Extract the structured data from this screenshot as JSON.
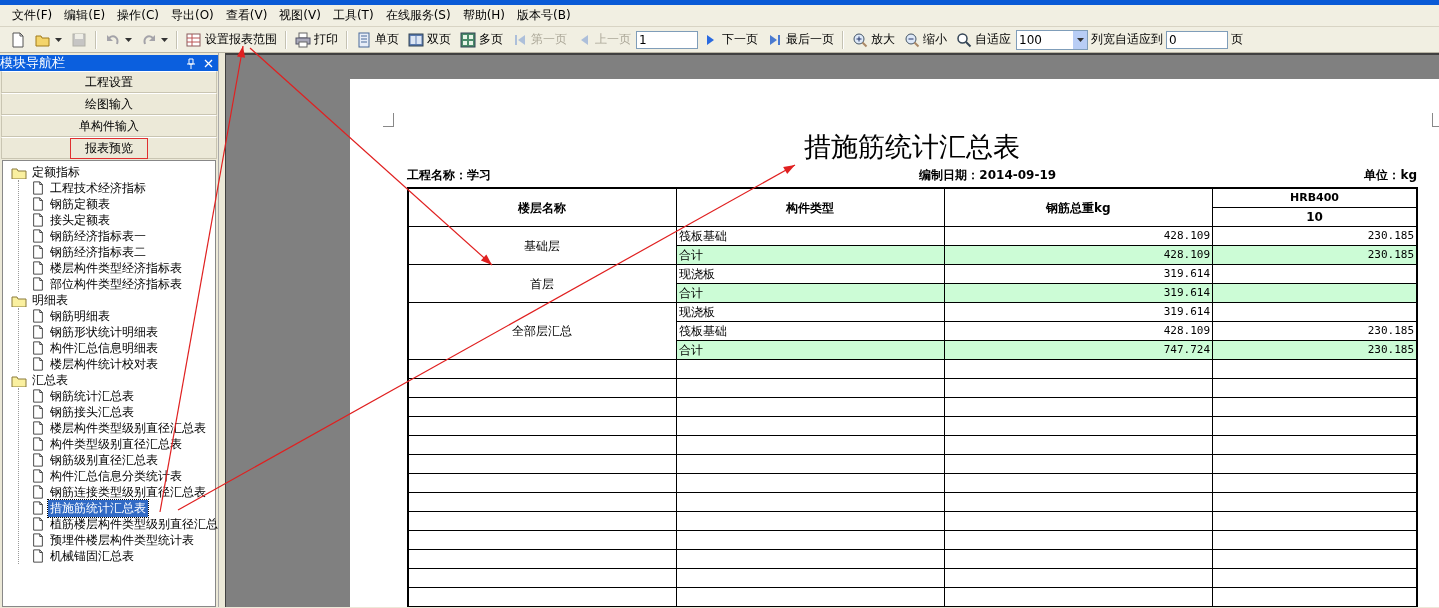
{
  "menu": [
    {
      "label": "文件(F)"
    },
    {
      "label": "编辑(E)"
    },
    {
      "label": "操作(C)"
    },
    {
      "label": "导出(O)"
    },
    {
      "label": "查看(V)"
    },
    {
      "label": "视图(V)"
    },
    {
      "label": "工具(T)"
    },
    {
      "label": "在线服务(S)"
    },
    {
      "label": "帮助(H)"
    },
    {
      "label": "版本号(B)"
    }
  ],
  "toolbar": [
    {
      "kind": "icon-button",
      "disabled": false,
      "dropdown": false
    },
    {
      "kind": "icon-button",
      "disabled": false,
      "dropdown": true
    },
    {
      "kind": "icon-button",
      "disabled": true,
      "dropdown": false
    },
    {
      "kind": "separator"
    },
    {
      "kind": "icon-button",
      "disabled": true,
      "dropdown": true
    },
    {
      "kind": "icon-button",
      "disabled": true,
      "dropdown": true
    },
    {
      "kind": "separator"
    },
    {
      "kind": "button",
      "label": "设置报表范围",
      "disabled": false
    },
    {
      "kind": "separator"
    },
    {
      "kind": "button",
      "label": "打印",
      "disabled": false
    },
    {
      "kind": "separator"
    },
    {
      "kind": "button",
      "label": "单页",
      "disabled": false
    },
    {
      "kind": "button",
      "label": "双页",
      "disabled": false
    },
    {
      "kind": "button",
      "label": "多页",
      "disabled": false
    },
    {
      "kind": "button",
      "label": "第一页",
      "disabled": true
    },
    {
      "kind": "button",
      "label": "上一页",
      "disabled": true
    },
    {
      "kind": "input",
      "value": "1"
    },
    {
      "kind": "button",
      "label": "下一页",
      "disabled": false
    },
    {
      "kind": "button",
      "label": "最后一页",
      "disabled": false
    },
    {
      "kind": "separator"
    },
    {
      "kind": "button",
      "label": "放大",
      "disabled": false
    },
    {
      "kind": "button",
      "label": "缩小",
      "disabled": false
    },
    {
      "kind": "button",
      "label": "自适应",
      "disabled": false
    },
    {
      "kind": "select",
      "value": "100"
    },
    {
      "kind": "text",
      "label": "列宽自适应到"
    },
    {
      "kind": "input",
      "value": "0"
    },
    {
      "kind": "text",
      "label": "页"
    }
  ],
  "sidebar": {
    "title": "模块导航栏",
    "modules": [
      {
        "label": "工程设置",
        "highlighted": false
      },
      {
        "label": "绘图输入",
        "highlighted": false
      },
      {
        "label": "单构件输入",
        "highlighted": false
      },
      {
        "label": "报表预览",
        "highlighted": true
      }
    ],
    "tree": [
      {
        "label": "定额指标",
        "selected": false,
        "children": [
          {
            "label": "工程技术经济指标",
            "selected": false
          },
          {
            "label": "钢筋定额表",
            "selected": false
          },
          {
            "label": "接头定额表",
            "selected": false
          },
          {
            "label": "钢筋经济指标表一",
            "selected": false
          },
          {
            "label": "钢筋经济指标表二",
            "selected": false
          },
          {
            "label": "楼层构件类型经济指标表",
            "selected": false
          },
          {
            "label": "部位构件类型经济指标表",
            "selected": false
          }
        ]
      },
      {
        "label": "明细表",
        "selected": false,
        "children": [
          {
            "label": "钢筋明细表",
            "selected": false
          },
          {
            "label": "钢筋形状统计明细表",
            "selected": false
          },
          {
            "label": "构件汇总信息明细表",
            "selected": false
          },
          {
            "label": "楼层构件统计校对表",
            "selected": false
          }
        ]
      },
      {
        "label": "汇总表",
        "selected": false,
        "children": [
          {
            "label": "钢筋统计汇总表",
            "selected": false
          },
          {
            "label": "钢筋接头汇总表",
            "selected": false
          },
          {
            "label": "楼层构件类型级别直径汇总表",
            "selected": false
          },
          {
            "label": "构件类型级别直径汇总表",
            "selected": false
          },
          {
            "label": "钢筋级别直径汇总表",
            "selected": false
          },
          {
            "label": "构件汇总信息分类统计表",
            "selected": false
          },
          {
            "label": "钢筋连接类型级别直径汇总表",
            "selected": false
          },
          {
            "label": "措施筋统计汇总表",
            "selected": true
          },
          {
            "label": "植筋楼层构件类型级别直径汇总",
            "selected": false
          },
          {
            "label": "预埋件楼层构件类型统计表",
            "selected": false
          },
          {
            "label": "机械锚固汇总表",
            "selected": false
          }
        ]
      }
    ]
  },
  "report": {
    "title": "措施筋统计汇总表",
    "project": "工程名称：学习",
    "date": "编制日期：2014-09-19",
    "unit": "单位：kg",
    "columns": [
      "楼层名称",
      "构件类型",
      "钢筋总重kg"
    ],
    "group_header": "HRB400",
    "sub_column": "10",
    "groups": [
      {
        "floor": "基础层",
        "rows": [
          {
            "type": "筏板基础",
            "total": "428.109",
            "hrb400_10": "230.185",
            "subtotal": false
          },
          {
            "type": "合计",
            "total": "428.109",
            "hrb400_10": "230.185",
            "subtotal": true
          }
        ]
      },
      {
        "floor": "首层",
        "rows": [
          {
            "type": "现浇板",
            "total": "319.614",
            "subtotal": false
          },
          {
            "type": "合计",
            "total": "319.614",
            "subtotal": true
          }
        ]
      },
      {
        "floor": "全部层汇总",
        "rows": [
          {
            "type": "现浇板",
            "total": "319.614",
            "subtotal": false
          },
          {
            "type": "筏板基础",
            "total": "428.109",
            "hrb400_10": "230.185",
            "subtotal": false
          },
          {
            "type": "合计",
            "total": "747.724",
            "hrb400_10": "230.185",
            "subtotal": true
          }
        ]
      }
    ]
  }
}
